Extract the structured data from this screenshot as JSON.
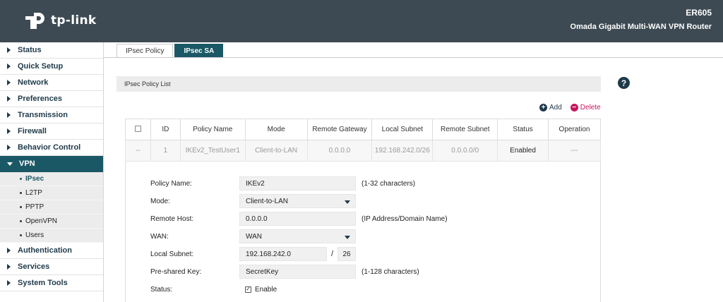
{
  "header": {
    "logo_text": "tp-link",
    "model": "ER605",
    "model_desc": "Omada Gigabit Multi-WAN VPN Router"
  },
  "sidebar": {
    "items": [
      {
        "label": "Status"
      },
      {
        "label": "Quick Setup"
      },
      {
        "label": "Network"
      },
      {
        "label": "Preferences"
      },
      {
        "label": "Transmission"
      },
      {
        "label": "Firewall"
      },
      {
        "label": "Behavior Control"
      },
      {
        "label": "VPN"
      },
      {
        "label": "Authentication"
      },
      {
        "label": "Services"
      },
      {
        "label": "System Tools"
      }
    ],
    "vpn_sub": [
      {
        "label": "IPsec"
      },
      {
        "label": "L2TP"
      },
      {
        "label": "PPTP"
      },
      {
        "label": "OpenVPN"
      },
      {
        "label": "Users"
      }
    ]
  },
  "tabs": [
    {
      "label": "IPsec Policy"
    },
    {
      "label": "IPsec SA"
    }
  ],
  "section_title": "IPsec Policy List",
  "help_glyph": "?",
  "actions": {
    "add": "Add",
    "delete": "Delete",
    "add_glyph": "+",
    "delete_glyph": "−"
  },
  "table": {
    "headers": [
      "ID",
      "Policy Name",
      "Mode",
      "Remote Gateway",
      "Local Subnet",
      "Remote Subnet",
      "Status",
      "Operation"
    ],
    "row": {
      "select": "--",
      "id": "1",
      "policy_name": "IKEv2_TestUser1",
      "mode": "Client-to-LAN",
      "remote_gateway": "0.0.0.0",
      "local_subnet": "192.168.242.0/26",
      "remote_subnet": "0.0.0.0/0",
      "status": "Enabled",
      "operation": "---"
    }
  },
  "form": {
    "policy_name": {
      "label": "Policy Name:",
      "value": "IKEv2",
      "hint": "(1-32 characters)"
    },
    "mode": {
      "label": "Mode:",
      "value": "Client-to-LAN"
    },
    "remote_host": {
      "label": "Remote Host:",
      "value": "0.0.0.0",
      "hint": "(IP Address/Domain Name)"
    },
    "wan": {
      "label": "WAN:",
      "value": "WAN"
    },
    "local_subnet": {
      "label": "Local Subnet:",
      "ip": "192.168.242.0",
      "separator": "/",
      "mask": "26"
    },
    "psk": {
      "label": "Pre-shared Key:",
      "value": "SecretKey",
      "hint": "(1-128 characters)"
    },
    "status": {
      "label": "Status:",
      "checkbox_label": "Enable",
      "checked": true,
      "check_glyph": "✓"
    }
  },
  "colors": {
    "header_bg": "#3d4a53",
    "accent": "#1b5866",
    "delete": "#c8155c",
    "nav_text": "#1f3a4a"
  }
}
